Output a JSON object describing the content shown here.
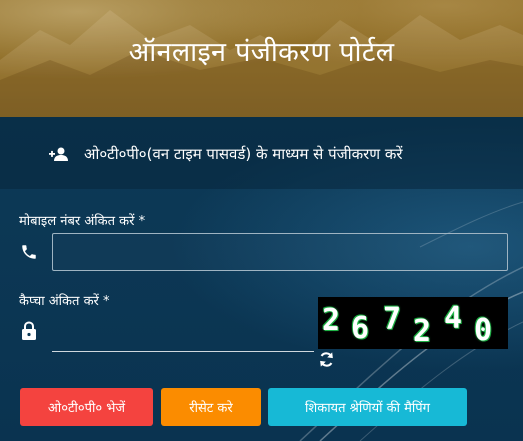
{
  "header": {
    "title": "ऑनलाइन पंजीकरण पोर्टल"
  },
  "subheader": {
    "icon": "add-user-icon",
    "text": "ओ०टी०पी०(वन टाइम पासवर्ड) के माध्यम से पंजीकरण करें"
  },
  "form": {
    "mobile": {
      "label": "मोबाइल नंबर अंकित करें *",
      "icon": "phone-icon",
      "value": "",
      "placeholder": ""
    },
    "captcha": {
      "label": "कैप्चा अंकित करें *",
      "icon": "lock-icon",
      "value": "",
      "placeholder": "",
      "digits": [
        "2",
        "6",
        "7",
        "2",
        "4",
        "0"
      ],
      "refresh_icon": "refresh-icon"
    }
  },
  "buttons": {
    "send_otp": "ओ०टी०पी० भेजें",
    "reset": "रीसेट करे",
    "mapping": "शिकायत श्रेणियों की मैपिंग"
  },
  "colors": {
    "header_bg": "#86631a",
    "panel_bg": "#0d3a57",
    "send_otp": "#f4433f",
    "reset": "#fb8c00",
    "mapping": "#17b9d6"
  }
}
